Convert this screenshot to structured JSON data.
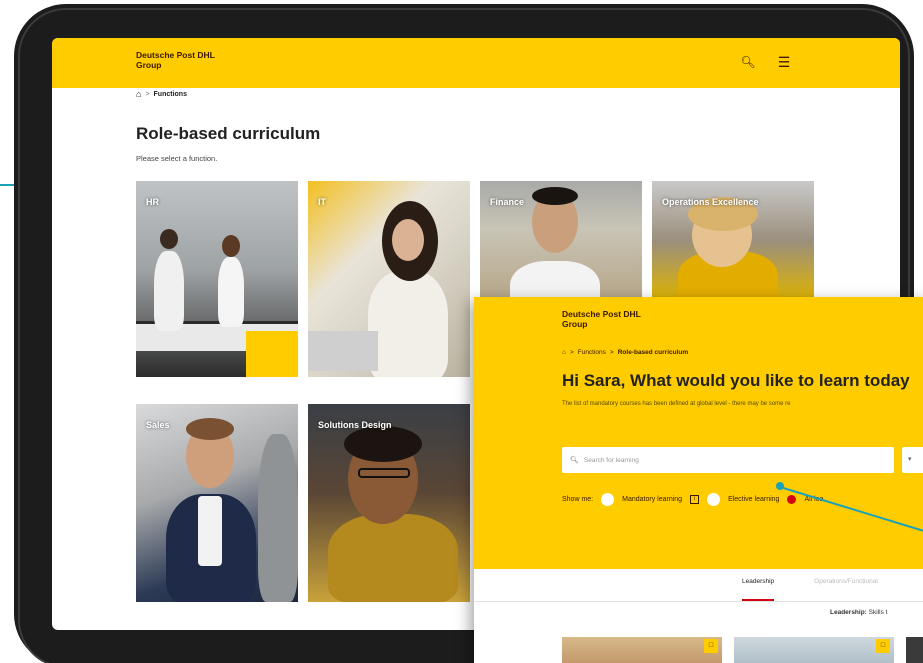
{
  "main": {
    "brand": "Deutsche Post DHL\nGroup",
    "brand_line1": "Deutsche Post DHL",
    "brand_line2": "Group",
    "breadcrumb": {
      "home_icon": "home-icon",
      "separator": ">",
      "current": "Functions"
    },
    "title": "Role-based curriculum",
    "subtitle": "Please select a function.",
    "tiles": [
      {
        "label": "HR"
      },
      {
        "label": "IT"
      },
      {
        "label": "Finance"
      },
      {
        "label": "Operations Excellence"
      },
      {
        "label": "Sales"
      },
      {
        "label": "Solutions Design"
      }
    ]
  },
  "overlay": {
    "brand_line1": "Deutsche Post DHL",
    "brand_line2": "Group",
    "breadcrumb": {
      "separator": ">",
      "item1": "Functions",
      "current": "Role-based curriculum"
    },
    "title": "Hi Sara, What would you like to learn today",
    "description": "The list of mandatory courses has been defined at global level - there may be some re",
    "search_placeholder": "Search for learning",
    "show_me_label": "Show me:",
    "filters": {
      "mandatory": "Mandatory learning",
      "elective": "Elective learning",
      "all": "All lea"
    },
    "tabs": {
      "leadership": "Leadership",
      "operations": "Operations/Functional"
    },
    "leadership_heading": "Leadership:",
    "leadership_text": "Skills t"
  },
  "colors": {
    "brand_yellow": "#ffcc00",
    "brand_red": "#d40511",
    "callout": "#1aa3b8"
  }
}
